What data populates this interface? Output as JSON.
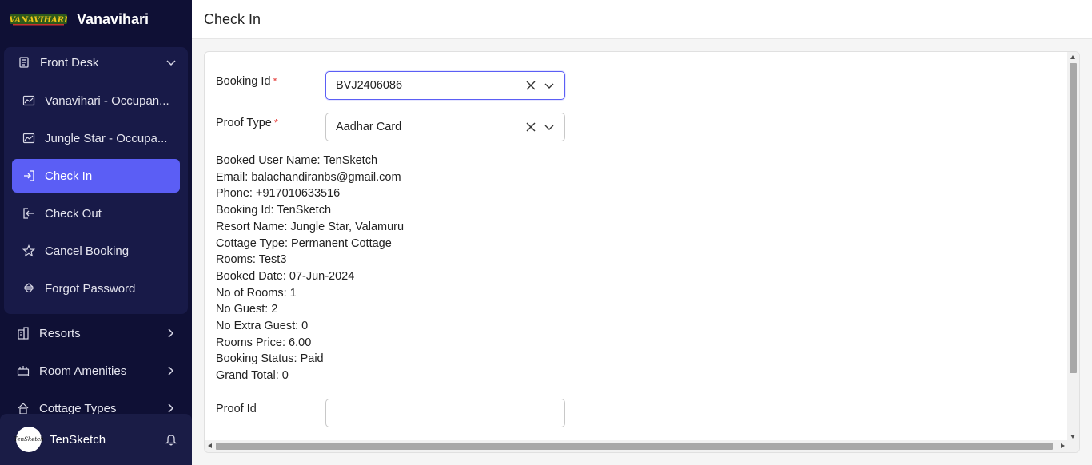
{
  "app": {
    "name": "Vanavihari"
  },
  "sidebar": {
    "group": {
      "label": "Front Desk",
      "items": [
        {
          "label": "Vanavihari - Occupan...",
          "icon": "chart-icon"
        },
        {
          "label": "Jungle Star - Occupa...",
          "icon": "chart-icon"
        },
        {
          "label": "Check In",
          "icon": "login-icon",
          "active": true
        },
        {
          "label": "Check Out",
          "icon": "logout-icon"
        },
        {
          "label": "Cancel Booking",
          "icon": "star-icon"
        },
        {
          "label": "Forgot Password",
          "icon": "user-lock-icon"
        }
      ]
    },
    "items": [
      {
        "label": "Resorts",
        "icon": "building-icon"
      },
      {
        "label": "Room Amenities",
        "icon": "amenity-icon"
      },
      {
        "label": "Cottage Types",
        "icon": "cottage-icon"
      }
    ],
    "user": {
      "name": "TenSketch",
      "avatar_text": "TenSketch"
    }
  },
  "header": {
    "title": "Check In"
  },
  "form": {
    "booking_id": {
      "label": "Booking Id",
      "required": "*",
      "value": "BVJ2406086"
    },
    "proof_type": {
      "label": "Proof Type",
      "required": "*",
      "value": "Aadhar Card"
    },
    "proof_id": {
      "label": "Proof Id",
      "value": ""
    }
  },
  "details": [
    "Booked User Name: TenSketch",
    "Email: balachandiranbs@gmail.com",
    "Phone: +917010633516",
    "Booking Id: TenSketch",
    "Resort Name: Jungle Star, Valamuru",
    "Cottage Type: Permanent Cottage",
    "Rooms: Test3",
    "Booked Date: 07-Jun-2024",
    "No of Rooms: 1",
    "No Guest: 2",
    "No Extra Guest: 0",
    "Rooms Price: 6.00",
    "Booking Status: Paid",
    "Grand Total: 0"
  ],
  "colors": {
    "sidebar_bg": "#0f1035",
    "accent": "#5b5ef5",
    "required": "#e53935"
  }
}
